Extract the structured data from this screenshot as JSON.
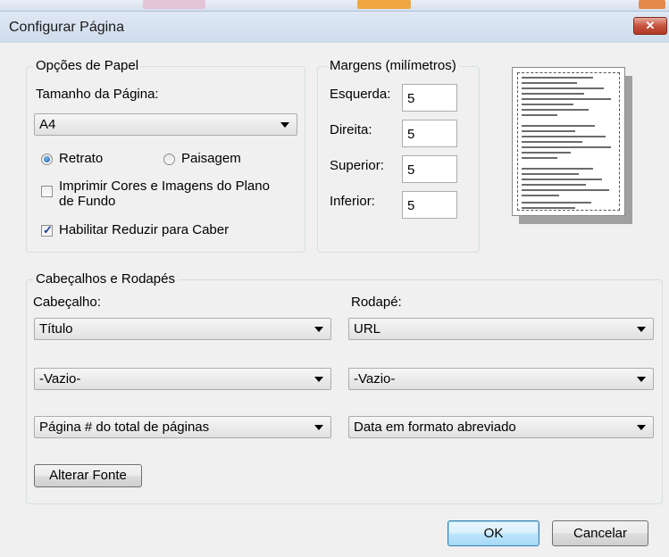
{
  "window": {
    "title": "Configurar Página",
    "close_glyph": "✕"
  },
  "paper_options": {
    "legend": "Opções de Papel",
    "page_size_label": "Tamanho da Página:",
    "page_size_value": "A4",
    "orientation": {
      "portrait_label": "Retrato",
      "landscape_label": "Paisagem",
      "selected": "Retrato"
    },
    "print_background_label_line1": "Imprimir Cores e Imagens do Plano",
    "print_background_label_line2": "de Fundo",
    "print_background_checked": false,
    "shrink_to_fit_label": "Habilitar Reduzir para Caber",
    "shrink_to_fit_checked": true
  },
  "margins": {
    "legend": "Margens (milímetros)",
    "left_label": "Esquerda:",
    "left_value": "5",
    "right_label": "Direita:",
    "right_value": "5",
    "top_label": "Superior:",
    "top_value": "5",
    "bottom_label": "Inferior:",
    "bottom_value": "5"
  },
  "headers_footers": {
    "legend": "Cabeçalhos e Rodapés",
    "header_label": "Cabeçalho:",
    "footer_label": "Rodapé:",
    "header_1": "Título",
    "header_2": "-Vazio-",
    "header_3": "Página # do total de páginas",
    "footer_1": "URL",
    "footer_2": "-Vazio-",
    "footer_3": "Data em formato abreviado",
    "change_font_button": "Alterar Fonte"
  },
  "buttons": {
    "ok": "OK",
    "cancel": "Cancelar"
  },
  "colors": {
    "close_button": "#c7533f",
    "checkmark": "#1c3f94",
    "radio_selected": "#1f5fa8"
  },
  "icons": {
    "close": "close-icon",
    "dropdown": "chevron-down-icon",
    "preview": "page-preview-icon"
  }
}
